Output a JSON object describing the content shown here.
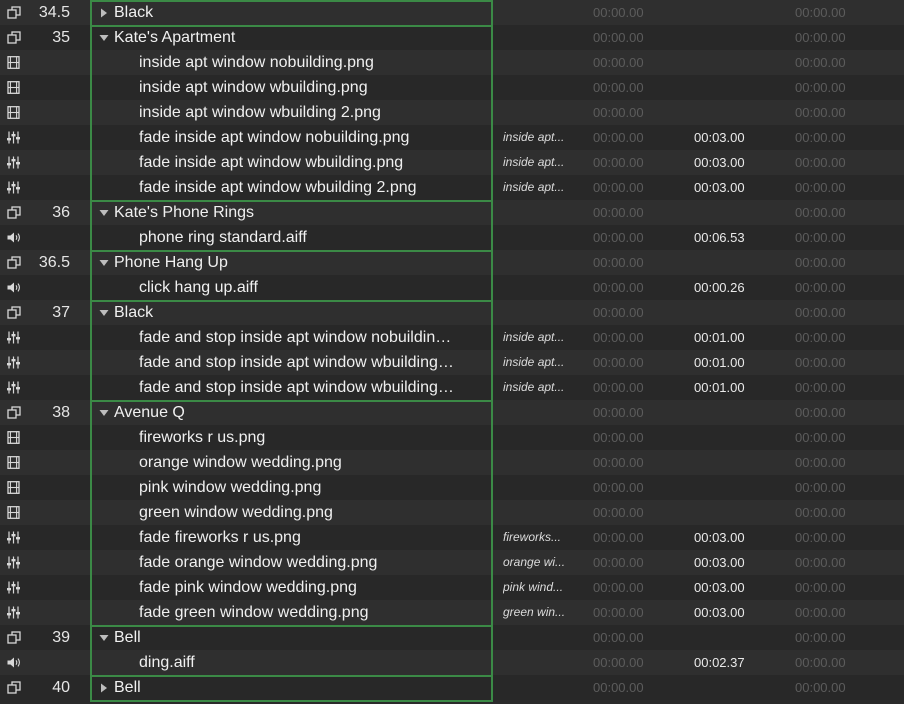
{
  "colors": {
    "group_border": "#3b8a46",
    "row_odd": "#2f2f2f",
    "row_even": "#282828",
    "text": "#f0f0f0",
    "dim_time": "#5c5c5c"
  },
  "cues": [
    {
      "kind": "group",
      "icon": "group-icon",
      "number": "34.5",
      "name": "Black",
      "expanded": false,
      "prewait": "00:00.00",
      "postwait": "00:00.00"
    },
    {
      "kind": "group",
      "icon": "group-icon",
      "number": "35",
      "name": "Kate's Apartment",
      "expanded": true,
      "prewait": "00:00.00",
      "postwait": "00:00.00"
    },
    {
      "kind": "child",
      "icon": "video-icon",
      "name": "inside apt window nobuilding.png",
      "prewait": "00:00.00",
      "postwait": "00:00.00"
    },
    {
      "kind": "child",
      "icon": "video-icon",
      "name": "inside apt window wbuilding.png",
      "prewait": "00:00.00",
      "postwait": "00:00.00"
    },
    {
      "kind": "child",
      "icon": "video-icon",
      "name": "inside apt window wbuilding 2.png",
      "prewait": "00:00.00",
      "postwait": "00:00.00"
    },
    {
      "kind": "child",
      "icon": "fade-icon",
      "name": "fade inside apt window nobuilding.png",
      "target": "inside apt...",
      "prewait": "00:00.00",
      "action": "00:03.00",
      "postwait": "00:00.00"
    },
    {
      "kind": "child",
      "icon": "fade-icon",
      "name": "fade inside apt window wbuilding.png",
      "target": "inside apt...",
      "prewait": "00:00.00",
      "action": "00:03.00",
      "postwait": "00:00.00"
    },
    {
      "kind": "child",
      "icon": "fade-icon",
      "name": "fade inside apt window wbuilding 2.png",
      "target": "inside apt...",
      "prewait": "00:00.00",
      "action": "00:03.00",
      "postwait": "00:00.00"
    },
    {
      "kind": "group",
      "icon": "group-icon",
      "number": "36",
      "name": "Kate's Phone Rings",
      "expanded": true,
      "prewait": "00:00.00",
      "postwait": "00:00.00"
    },
    {
      "kind": "child",
      "icon": "audio-icon",
      "name": "phone ring standard.aiff",
      "prewait": "00:00.00",
      "action": "00:06.53",
      "postwait": "00:00.00"
    },
    {
      "kind": "group",
      "icon": "group-icon",
      "number": "36.5",
      "name": "Phone Hang Up",
      "expanded": true,
      "prewait": "00:00.00",
      "postwait": "00:00.00"
    },
    {
      "kind": "child",
      "icon": "audio-icon",
      "name": "click hang up.aiff",
      "prewait": "00:00.00",
      "action": "00:00.26",
      "postwait": "00:00.00"
    },
    {
      "kind": "group",
      "icon": "group-icon",
      "number": "37",
      "name": "Black",
      "expanded": true,
      "prewait": "00:00.00",
      "postwait": "00:00.00"
    },
    {
      "kind": "child",
      "icon": "fade-icon",
      "name": "fade and stop inside apt window nobuildin…",
      "target": "inside apt...",
      "prewait": "00:00.00",
      "action": "00:01.00",
      "postwait": "00:00.00"
    },
    {
      "kind": "child",
      "icon": "fade-icon",
      "name": "fade and stop inside apt window wbuilding…",
      "target": "inside apt...",
      "prewait": "00:00.00",
      "action": "00:01.00",
      "postwait": "00:00.00"
    },
    {
      "kind": "child",
      "icon": "fade-icon",
      "name": "fade and stop inside apt window wbuilding…",
      "target": "inside apt...",
      "prewait": "00:00.00",
      "action": "00:01.00",
      "postwait": "00:00.00"
    },
    {
      "kind": "group",
      "icon": "group-icon",
      "number": "38",
      "name": "Avenue Q",
      "expanded": true,
      "prewait": "00:00.00",
      "postwait": "00:00.00"
    },
    {
      "kind": "child",
      "icon": "video-icon",
      "name": "fireworks r us.png",
      "prewait": "00:00.00",
      "postwait": "00:00.00"
    },
    {
      "kind": "child",
      "icon": "video-icon",
      "name": "orange window wedding.png",
      "prewait": "00:00.00",
      "postwait": "00:00.00"
    },
    {
      "kind": "child",
      "icon": "video-icon",
      "name": "pink window wedding.png",
      "prewait": "00:00.00",
      "postwait": "00:00.00"
    },
    {
      "kind": "child",
      "icon": "video-icon",
      "name": "green window wedding.png",
      "prewait": "00:00.00",
      "postwait": "00:00.00"
    },
    {
      "kind": "child",
      "icon": "fade-icon",
      "name": "fade fireworks r us.png",
      "target": "fireworks...",
      "prewait": "00:00.00",
      "action": "00:03.00",
      "postwait": "00:00.00"
    },
    {
      "kind": "child",
      "icon": "fade-icon",
      "name": "fade orange window wedding.png",
      "target": "orange wi...",
      "prewait": "00:00.00",
      "action": "00:03.00",
      "postwait": "00:00.00"
    },
    {
      "kind": "child",
      "icon": "fade-icon",
      "name": "fade pink window wedding.png",
      "target": "pink wind...",
      "prewait": "00:00.00",
      "action": "00:03.00",
      "postwait": "00:00.00"
    },
    {
      "kind": "child",
      "icon": "fade-icon",
      "name": "fade green window wedding.png",
      "target": "green win...",
      "prewait": "00:00.00",
      "action": "00:03.00",
      "postwait": "00:00.00"
    },
    {
      "kind": "group",
      "icon": "group-icon",
      "number": "39",
      "name": "Bell",
      "expanded": true,
      "prewait": "00:00.00",
      "postwait": "00:00.00"
    },
    {
      "kind": "child",
      "icon": "audio-icon",
      "name": "ding.aiff",
      "prewait": "00:00.00",
      "action": "00:02.37",
      "postwait": "00:00.00"
    },
    {
      "kind": "group",
      "icon": "group-icon",
      "number": "40",
      "name": "Bell",
      "expanded": false,
      "prewait": "00:00.00",
      "postwait": "00:00.00"
    }
  ]
}
